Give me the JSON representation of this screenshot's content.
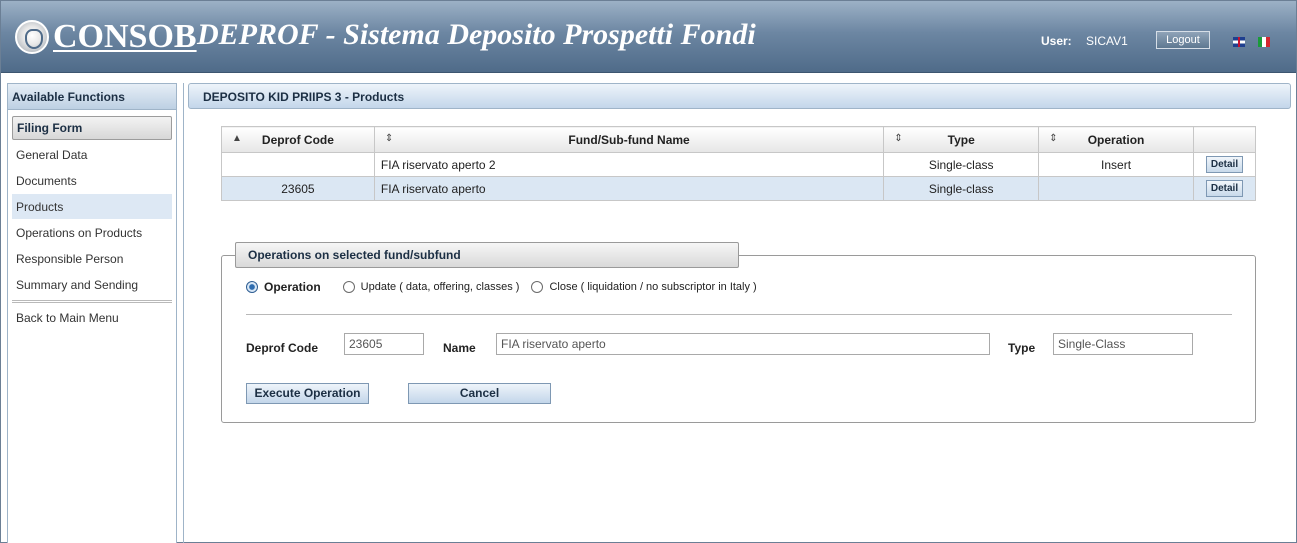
{
  "header": {
    "logo_text": "CONSOB",
    "title": "DEPROF - Sistema Deposito Prospetti Fondi",
    "user_label": "User:",
    "user_value": "SICAV1",
    "logout_label": "Logout"
  },
  "sidebar": {
    "heading": "Available Functions",
    "section": "Filing Form",
    "items": [
      {
        "label": "General Data"
      },
      {
        "label": "Documents"
      },
      {
        "label": "Products"
      },
      {
        "label": "Operations on Products"
      },
      {
        "label": "Responsible Person"
      },
      {
        "label": "Summary and Sending"
      }
    ],
    "back_label": "Back to Main Menu"
  },
  "main": {
    "breadcrumb": "DEPOSITO KID PRIIPS 3 - Products",
    "table": {
      "columns": [
        "Deprof Code",
        "Fund/Sub-fund Name",
        "Type",
        "Operation"
      ],
      "rows": [
        {
          "code": "",
          "name": "FIA riservato aperto 2",
          "type": "Single-class",
          "operation": "Insert",
          "action": "Detail"
        },
        {
          "code": "23605",
          "name": "FIA riservato aperto",
          "type": "Single-class",
          "operation": "",
          "action": "Detail"
        }
      ]
    },
    "operations": {
      "legend": "Operations on selected fund/subfund",
      "radio_operation": "Operation",
      "radio_update": "Update ( data, offering, classes )",
      "radio_close": "Close ( liquidation / no subscriptor in Italy )",
      "code_label": "Deprof Code",
      "code_value": "23605",
      "name_label": "Name",
      "name_value": "FIA riservato aperto",
      "type_label": "Type",
      "type_value": "Single-Class",
      "execute_label": "Execute Operation",
      "cancel_label": "Cancel"
    }
  }
}
